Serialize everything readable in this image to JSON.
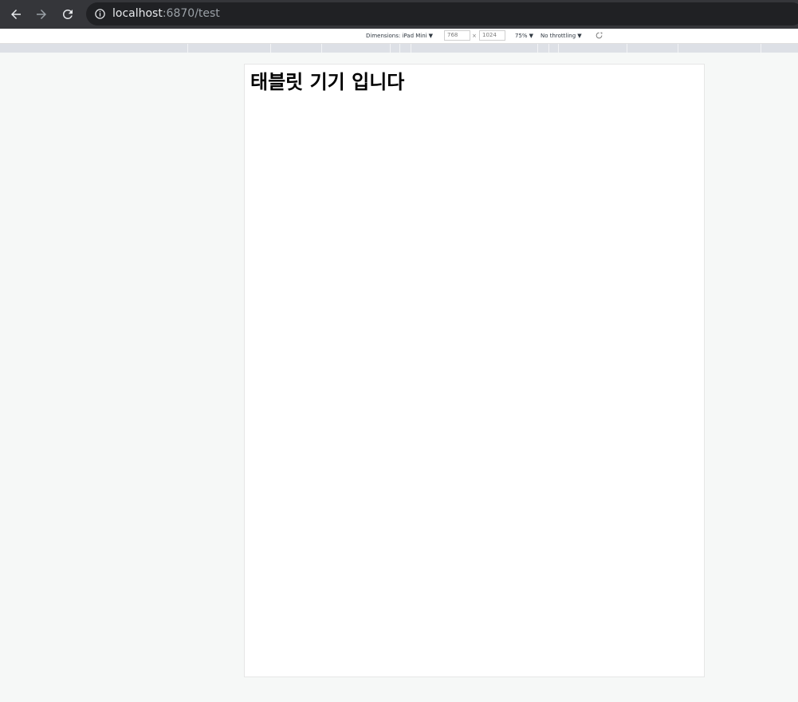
{
  "browser": {
    "url_host": "localhost",
    "url_rest": ":6870/test"
  },
  "device_toolbar": {
    "dimensions_label": "Dimensions: iPad Mini",
    "width_value": "768",
    "times_symbol": "×",
    "height_value": "1024",
    "zoom_label": "75%",
    "throttling_label": "No throttling",
    "caret_glyph": "▼"
  },
  "page": {
    "heading": "태블릿 기기 입니다"
  },
  "colors": {
    "toolbar_bg": "#35363a",
    "omnibox_bg": "#202124",
    "page_bg": "#f6f8f7",
    "ruler_bg": "#dde0e6"
  },
  "icons": {
    "back": "arrow-left-icon",
    "forward": "arrow-right-icon",
    "reload": "reload-icon",
    "info": "info-icon",
    "rotate": "rotate-icon"
  }
}
